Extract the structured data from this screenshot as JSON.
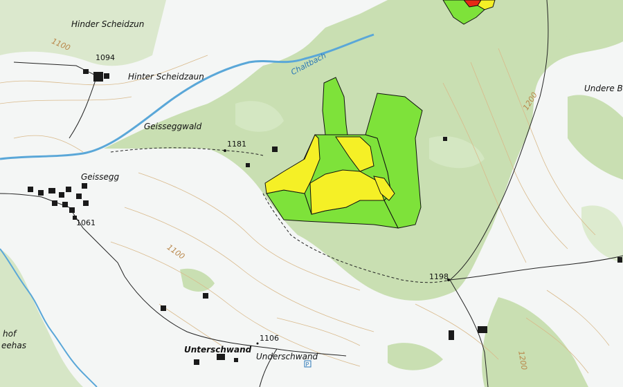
{
  "map": {
    "place_labels": {
      "hinder_scheidzun": "Hinder Scheidzun",
      "hinter_scheidzaun": "Hinter Scheidzaun",
      "geisseggwald": "Geisseggwald",
      "geissegg": "Geissegg",
      "undere_br": "Undere Br",
      "unterschwand": "Unterschwand",
      "underschwand": "Underschwand",
      "hof": "hof",
      "eehas": "eehas"
    },
    "water_labels": {
      "chaltbach": "Chaltbach"
    },
    "elevations": {
      "e1094": "1094",
      "e1181": "1181",
      "e1061": "1061",
      "e1198": "1198",
      "e1106": "1106"
    },
    "contour_labels": {
      "c1100_a": "1100",
      "c1100_b": "1100",
      "c1200_a": "1200",
      "c1200_b": "1200"
    },
    "colors": {
      "background": "#f4f6f5",
      "forest": "#c9dfb2",
      "meadow_patch": "#d7e8c6",
      "water": "#5aa7d8",
      "contour": "#d9b98a",
      "parcel_green": "#7ee23a",
      "parcel_yellow": "#f5f026",
      "parcel_red": "#e52a16",
      "building": "#1a1a1a"
    },
    "icons": [
      "parking-icon",
      "elevation-point-icon",
      "building-icon"
    ]
  }
}
